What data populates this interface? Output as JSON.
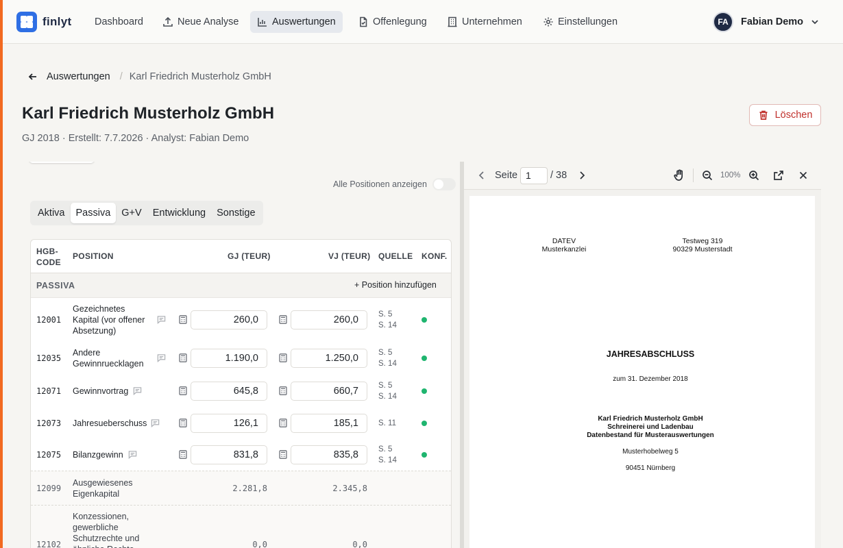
{
  "app": {
    "name": "finlyt",
    "accent_color": "#f26a21",
    "brand_color": "#2f6fe4"
  },
  "nav": {
    "items": [
      {
        "label": "Dashboard",
        "icon": ""
      },
      {
        "label": "Neue Analyse",
        "icon": "upload-icon"
      },
      {
        "label": "Auswertungen",
        "icon": "bar-chart-icon",
        "active": true
      },
      {
        "label": "Offenlegung",
        "icon": "document-check-icon"
      },
      {
        "label": "Unternehmen",
        "icon": "building-icon"
      },
      {
        "label": "Einstellungen",
        "icon": "gear-icon"
      }
    ],
    "user": {
      "initials": "FA",
      "name": "Fabian Demo"
    }
  },
  "breadcrumb": {
    "back_label": "Auswertungen",
    "current": "Karl Friedrich Musterholz GmbH"
  },
  "header": {
    "title": "Karl Friedrich Musterholz GmbH",
    "meta": "GJ 2018 · Erstellt: 7.7.2026 · Analyst: Fabian Demo",
    "delete_label": "Löschen"
  },
  "left": {
    "toggle_label": "Alle Positionen anzeigen",
    "toggle_on": false,
    "tabs": [
      "Aktiva",
      "Passiva",
      "G+V",
      "Entwicklung",
      "Sonstige"
    ],
    "active_tab": "Passiva",
    "table": {
      "headers": {
        "code": "HGB-CODE",
        "position": "POSITION",
        "gj": "GJ (TEUR)",
        "vj": "VJ (TEUR)",
        "source": "QUELLE",
        "conf": "KONF."
      },
      "section": {
        "label": "PASSIVA",
        "add_label": "+ Position hinzufügen"
      },
      "rows": [
        {
          "code": "12001",
          "position": "Gezeichnetes Kapital (vor offener Absetzung)",
          "gj": "260,0",
          "vj": "260,0",
          "source": [
            "S. 5",
            "S. 14"
          ],
          "conf_color": "#1fb56f"
        },
        {
          "code": "12035",
          "position": "Andere Gewinnruecklagen",
          "gj": "1.190,0",
          "vj": "1.250,0",
          "source": [
            "S. 5",
            "S. 14"
          ],
          "conf_color": "#1fb56f"
        },
        {
          "code": "12071",
          "position": "Gewinnvortrag",
          "gj": "645,8",
          "vj": "660,7",
          "source": [
            "S. 5",
            "S. 14"
          ],
          "conf_color": "#1fb56f"
        },
        {
          "code": "12073",
          "position": "Jahresueberschuss",
          "gj": "126,1",
          "vj": "185,1",
          "source": [
            "S. 11"
          ],
          "conf_color": "#1fb56f"
        },
        {
          "code": "12075",
          "position": "Bilanzgewinn",
          "gj": "831,8",
          "vj": "835,8",
          "source": [
            "S. 5",
            "S. 14"
          ],
          "conf_color": "#1fb56f"
        }
      ],
      "sums": [
        {
          "code": "12099",
          "position": "Ausgewiesenes Eigenkapital",
          "gj": "2.281,8",
          "vj": "2.345,8"
        },
        {
          "code": "12102",
          "position": "Konzessionen, gewerbliche Schutzrechte und ähnliche Rechte sowie",
          "gj": "0,0",
          "vj": "0,0"
        }
      ]
    }
  },
  "viewer": {
    "page_label": "Seite",
    "page_current": "1",
    "page_total": "/ 38",
    "zoom": "100%",
    "pdf": {
      "left_header": [
        "DATEV",
        "Musterkanzlei"
      ],
      "right_header": [
        "Testweg 319",
        "90329 Musterstadt"
      ],
      "heading": "JAHRESABSCHLUSS",
      "date_line": "zum 31. Dezember 2018",
      "company_lines": [
        "Karl Friedrich Musterholz GmbH",
        "Schreinerei und Ladenbau",
        "Datenbestand für Musterauswertungen"
      ],
      "street": "Musterhobelweg 5",
      "city": "90451 Nürnberg"
    }
  }
}
